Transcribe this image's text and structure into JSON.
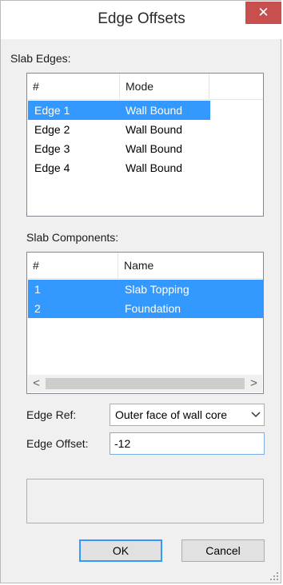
{
  "window": {
    "title": "Edge Offsets",
    "close_glyph": "✕"
  },
  "slab_edges": {
    "label": "Slab Edges:",
    "columns": [
      "#",
      "Mode"
    ],
    "rows": [
      {
        "num": "Edge 1",
        "mode": "Wall Bound",
        "selected": true
      },
      {
        "num": "Edge 2",
        "mode": "Wall Bound",
        "selected": false
      },
      {
        "num": "Edge 3",
        "mode": "Wall Bound",
        "selected": false
      },
      {
        "num": "Edge 4",
        "mode": "Wall Bound",
        "selected": false
      }
    ]
  },
  "slab_components": {
    "label": "Slab Components:",
    "columns": [
      "#",
      "Name"
    ],
    "rows": [
      {
        "num": "1",
        "name": "Slab Topping",
        "selected": true
      },
      {
        "num": "2",
        "name": "Foundation",
        "selected": true
      }
    ],
    "scroll_left": "<",
    "scroll_right": ">"
  },
  "edge_ref": {
    "label": "Edge Ref:",
    "value": "Outer face of wall core"
  },
  "edge_offset": {
    "label": "Edge Offset:",
    "value": "-12"
  },
  "buttons": {
    "ok": "OK",
    "cancel": "Cancel"
  },
  "colors": {
    "selection": "#3399ff",
    "close": "#c7504f"
  }
}
